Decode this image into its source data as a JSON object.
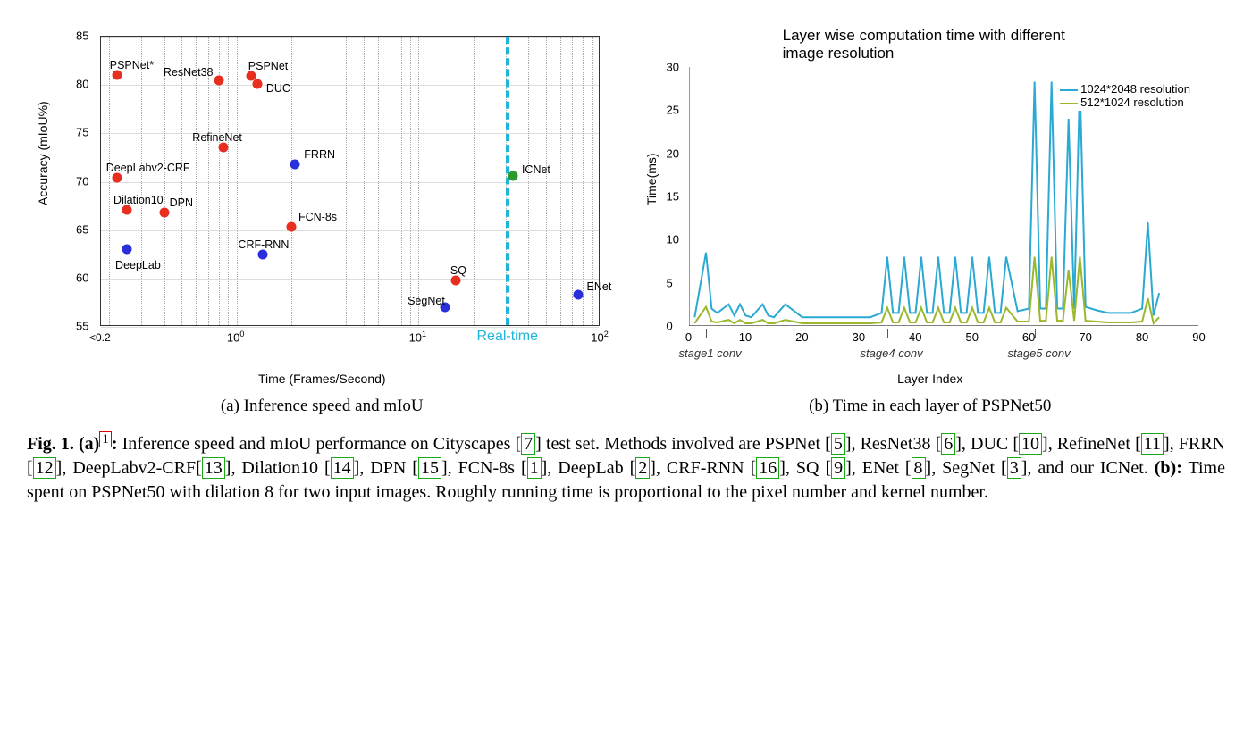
{
  "chart_data": [
    {
      "type": "scatter",
      "title": "",
      "xlabel": "Time (Frames/Second)",
      "ylabel": "Accuracy (mIoU%)",
      "ylim": [
        55,
        85
      ],
      "x_scale": "log",
      "x_ticks": [
        "<0.2",
        "10^0",
        "10^1",
        "10^2"
      ],
      "realtime_marker_fps": 30,
      "points": [
        {
          "label": "PSPNet*",
          "fps": 0.22,
          "miou": 81,
          "color": "red",
          "lx": -8,
          "ly": -18
        },
        {
          "label": "ResNet38",
          "fps": 0.8,
          "miou": 80.5,
          "color": "red",
          "lx": -62,
          "ly": -16
        },
        {
          "label": "PSPNet",
          "fps": 1.2,
          "miou": 80.9,
          "color": "red",
          "lx": -3,
          "ly": -18
        },
        {
          "label": "DUC",
          "fps": 1.3,
          "miou": 80.1,
          "color": "red",
          "lx": 10,
          "ly": -2
        },
        {
          "label": "RefineNet",
          "fps": 0.85,
          "miou": 73.6,
          "color": "red",
          "lx": -35,
          "ly": -18
        },
        {
          "label": "FRRN",
          "fps": 2.1,
          "miou": 71.8,
          "color": "blue",
          "lx": 10,
          "ly": -18
        },
        {
          "label": "DeepLabv2-CRF",
          "fps": 0.22,
          "miou": 70.4,
          "color": "red",
          "lx": -12,
          "ly": -18
        },
        {
          "label": "Dilation10",
          "fps": 0.25,
          "miou": 67.1,
          "color": "red",
          "lx": -15,
          "ly": -18
        },
        {
          "label": "DPN",
          "fps": 0.4,
          "miou": 66.8,
          "color": "red",
          "lx": 6,
          "ly": -18
        },
        {
          "label": "FCN-8s",
          "fps": 2,
          "miou": 65.3,
          "color": "red",
          "lx": 8,
          "ly": -18
        },
        {
          "label": "DeepLab",
          "fps": 0.25,
          "miou": 63,
          "color": "blue",
          "lx": -13,
          "ly": 11
        },
        {
          "label": "CRF-RNN",
          "fps": 1.4,
          "miou": 62.5,
          "color": "blue",
          "lx": -28,
          "ly": -18
        },
        {
          "label": "SQ",
          "fps": 16,
          "miou": 59.8,
          "color": "red",
          "lx": -6,
          "ly": -18
        },
        {
          "label": "SegNet",
          "fps": 14,
          "miou": 57,
          "color": "blue",
          "lx": -42,
          "ly": -14
        },
        {
          "label": "ENet",
          "fps": 75,
          "miou": 58.3,
          "color": "blue",
          "lx": 10,
          "ly": -16
        },
        {
          "label": "ICNet",
          "fps": 33,
          "miou": 70.6,
          "color": "green",
          "lx": 10,
          "ly": -14
        }
      ],
      "subcaption": "(a) Inference speed and mIoU"
    },
    {
      "type": "line",
      "title": "Layer wise computation time with different image resolution",
      "xlabel": "Layer Index",
      "ylabel": "Time(ms)",
      "ylim": [
        0,
        30
      ],
      "xlim": [
        0,
        90
      ],
      "x_ticks": [
        0,
        10,
        20,
        30,
        40,
        50,
        60,
        70,
        80,
        90
      ],
      "y_ticks": [
        0,
        5,
        10,
        15,
        20,
        25,
        30
      ],
      "legend": [
        "1024*2048 resolution",
        "512*1024 resolution"
      ],
      "series": [
        {
          "name": "1024*2048 resolution",
          "color": "#2aa9d2",
          "x": [
            1,
            3,
            4,
            5,
            7,
            8,
            9,
            10,
            11,
            13,
            14,
            15,
            17,
            20,
            22,
            24,
            26,
            28,
            30,
            32,
            34,
            35,
            36,
            37,
            38,
            39,
            40,
            41,
            42,
            43,
            44,
            45,
            46,
            47,
            48,
            49,
            50,
            51,
            52,
            53,
            54,
            55,
            56,
            58,
            60,
            61,
            62,
            63,
            64,
            65,
            66,
            67,
            68,
            69,
            70,
            72,
            74,
            76,
            78,
            80,
            81,
            82,
            83
          ],
          "y": [
            1,
            8.5,
            2,
            1.5,
            2.5,
            1.2,
            2.5,
            1.2,
            1,
            2.5,
            1.2,
            1,
            2.5,
            1,
            1,
            1,
            1,
            1,
            1,
            1,
            1.5,
            8,
            1.5,
            1.5,
            8,
            1.5,
            1.5,
            8,
            1.5,
            1.5,
            8,
            1.5,
            1.5,
            8,
            1.5,
            1.5,
            8,
            1.5,
            1.5,
            8,
            1.5,
            1.5,
            8,
            1.7,
            2,
            28.3,
            2,
            2,
            28.3,
            2,
            2,
            24,
            2,
            28.3,
            2.2,
            1.8,
            1.5,
            1.5,
            1.5,
            2,
            12,
            1.2,
            3.8
          ]
        },
        {
          "name": "512*1024 resolution",
          "color": "#9ab82c",
          "x": [
            1,
            3,
            4,
            5,
            7,
            8,
            9,
            10,
            11,
            13,
            14,
            15,
            17,
            20,
            22,
            24,
            26,
            28,
            30,
            32,
            34,
            35,
            36,
            37,
            38,
            39,
            40,
            41,
            42,
            43,
            44,
            45,
            46,
            47,
            48,
            49,
            50,
            51,
            52,
            53,
            54,
            55,
            56,
            58,
            60,
            61,
            62,
            63,
            64,
            65,
            66,
            67,
            68,
            69,
            70,
            72,
            74,
            76,
            78,
            80,
            81,
            82,
            83
          ],
          "y": [
            0.3,
            2.2,
            0.5,
            0.4,
            0.7,
            0.3,
            0.7,
            0.3,
            0.3,
            0.7,
            0.3,
            0.3,
            0.7,
            0.3,
            0.3,
            0.3,
            0.3,
            0.3,
            0.3,
            0.3,
            0.4,
            2.1,
            0.4,
            0.4,
            2.1,
            0.4,
            0.4,
            2.1,
            0.4,
            0.4,
            2.1,
            0.4,
            0.4,
            2.1,
            0.4,
            0.4,
            2.1,
            0.4,
            0.4,
            2.1,
            0.4,
            0.4,
            2.1,
            0.5,
            0.5,
            8.0,
            0.6,
            0.6,
            8.0,
            0.6,
            0.6,
            6.5,
            0.6,
            8.0,
            0.6,
            0.5,
            0.4,
            0.4,
            0.4,
            0.5,
            3.2,
            0.3,
            1
          ]
        }
      ],
      "stage_annotations": [
        {
          "label": "stage1 conv",
          "x": 3
        },
        {
          "label": "stage4 conv",
          "x": 35
        },
        {
          "label": "stage5 conv",
          "x": 61
        }
      ],
      "subcaption": "(b) Time in each layer of PSPNet50"
    }
  ],
  "caption": {
    "fignum": "Fig. 1.",
    "part_a_pre": "(a)",
    "foot": "1",
    "colon": ":",
    "text1": " Inference speed and mIoU performance on Cityscapes ",
    "ref7": "7",
    "text2": " test set. Methods involved are PSPNet ",
    "ref5": "5",
    "text3": ", ResNet38 ",
    "ref6": "6",
    "text4": ", DUC ",
    "ref10": "10",
    "text5": ", RefineNet ",
    "ref11": "11",
    "text6": ", FRRN ",
    "ref12": "12",
    "text7": ", DeepLabv2-CRF",
    "ref13": "13",
    "text8": ", Dilation10 ",
    "ref14": "14",
    "text9": ", DPN ",
    "ref15": "15",
    "text10": ", FCN-8s ",
    "ref1": "1",
    "text11": ", DeepLab ",
    "ref2": "2",
    "text12": ", CRF-RNN ",
    "ref16": "16",
    "text13": ", SQ ",
    "ref9": "9",
    "text14": ", ENet ",
    "ref8": "8",
    "text15": ", SegNet ",
    "ref3": "3",
    "text16": ", and our ICNet. ",
    "part_b": "(b):",
    "text17": " Time spent on PSPNet50 with dilation 8 for two input images. Roughly running time is proportional to the pixel number and kernel number."
  }
}
